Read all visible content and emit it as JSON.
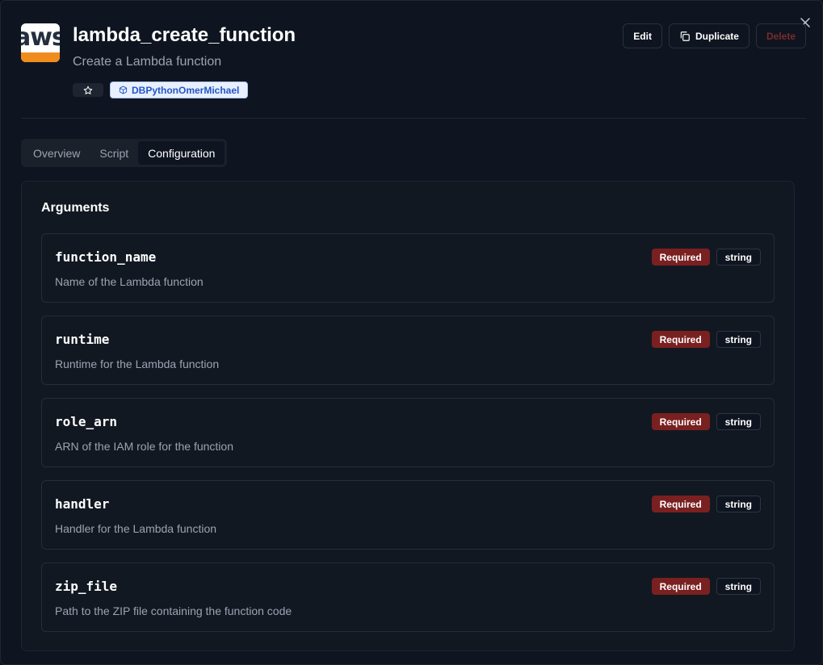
{
  "header": {
    "logo_text": "aws",
    "title": "lambda_create_function",
    "subtitle": "Create a Lambda function",
    "owner_tag": "DBPythonOmerMichael",
    "star_icon": "star-icon",
    "owner_icon": "cube-icon"
  },
  "actions": {
    "edit_label": "Edit",
    "duplicate_label": "Duplicate",
    "delete_label": "Delete"
  },
  "tabs": [
    {
      "label": "Overview",
      "active": false
    },
    {
      "label": "Script",
      "active": false
    },
    {
      "label": "Configuration",
      "active": true
    }
  ],
  "arguments": {
    "title": "Arguments",
    "items": [
      {
        "name": "function_name",
        "description": "Name of the Lambda function",
        "required_label": "Required",
        "type": "string"
      },
      {
        "name": "runtime",
        "description": "Runtime for the Lambda function",
        "required_label": "Required",
        "type": "string"
      },
      {
        "name": "role_arn",
        "description": "ARN of the IAM role for the function",
        "required_label": "Required",
        "type": "string"
      },
      {
        "name": "handler",
        "description": "Handler for the Lambda function",
        "required_label": "Required",
        "type": "string"
      },
      {
        "name": "zip_file",
        "description": "Path to the ZIP file containing the function code",
        "required_label": "Required",
        "type": "string"
      }
    ]
  },
  "colors": {
    "required_badge": "#7a2020",
    "owner_tag_bg": "#e8f0fe",
    "owner_tag_text": "#2456c7",
    "logo_orange": "#f08c1e"
  }
}
